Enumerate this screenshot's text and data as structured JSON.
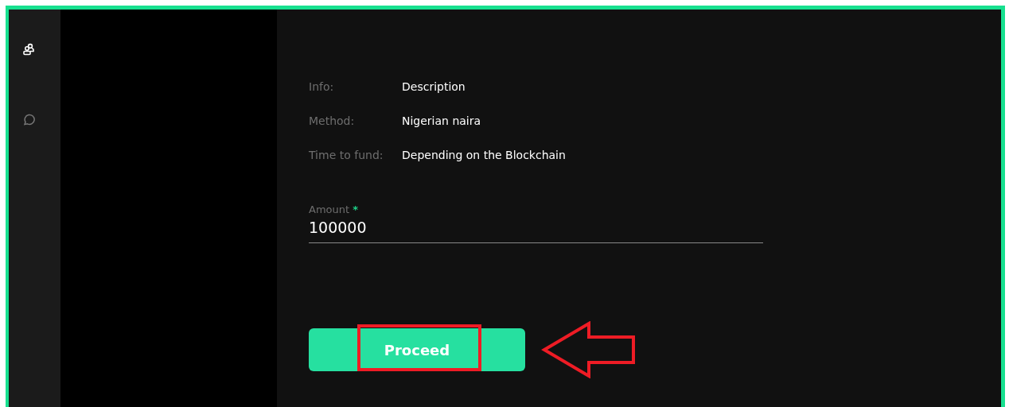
{
  "sidebar": {
    "items": [
      {
        "kind": "users",
        "selected": true
      },
      {
        "kind": "chat",
        "selected": false
      }
    ]
  },
  "details": [
    {
      "label": "Info:",
      "value": "Description"
    },
    {
      "label": "Method:",
      "value": "Nigerian naira"
    },
    {
      "label": "Time to fund:",
      "value": "Depending on the Blockchain"
    }
  ],
  "amount_field": {
    "label": "Amount",
    "required_mark": "*",
    "value": "100000"
  },
  "proceed_button": {
    "label": "Proceed",
    "highlighted": true
  }
}
